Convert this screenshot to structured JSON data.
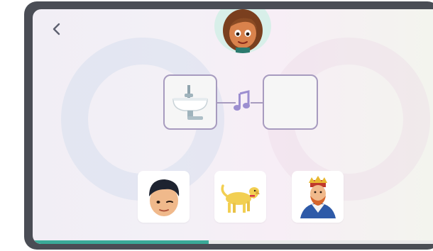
{
  "colors": {
    "frame": "#4a4d55",
    "card_border": "#a79bbf",
    "note": "#9c8ed0",
    "progress": "#3aaa98",
    "progress_track": "#e9e9ea"
  },
  "header": {
    "back_icon": "chevron-left-icon",
    "avatar": "girl-avatar"
  },
  "puzzle": {
    "left_card_icon": "sink-icon",
    "connector_icon": "music-note-icon",
    "right_card_state": "empty"
  },
  "options": [
    {
      "icon": "boy-face-icon"
    },
    {
      "icon": "dog-icon"
    },
    {
      "icon": "king-icon"
    }
  ],
  "progress": {
    "fraction": 0.44
  }
}
